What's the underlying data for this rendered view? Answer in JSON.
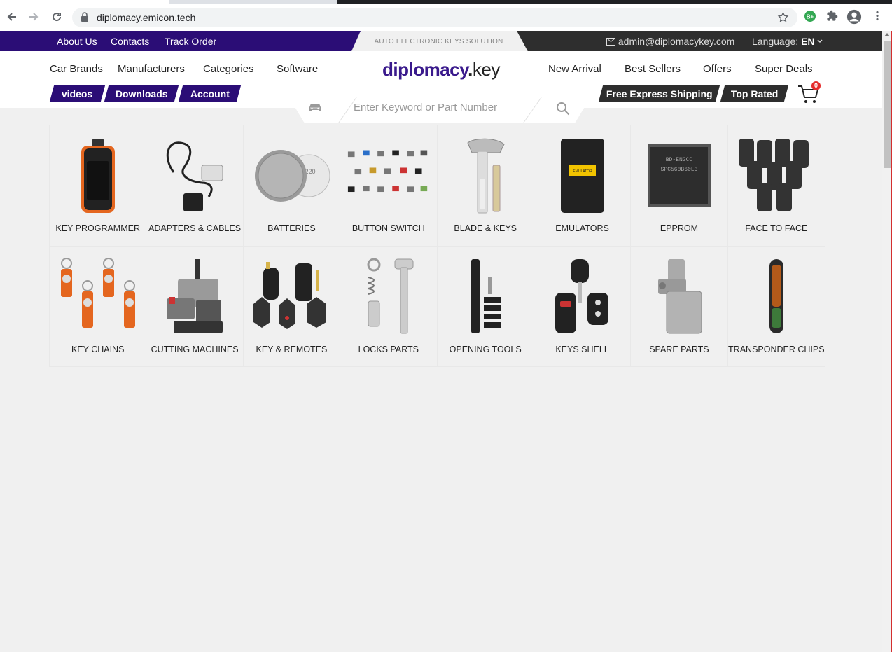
{
  "browser": {
    "url": "diplomacy.emicon.tech",
    "back_icon": "arrow-left-icon",
    "forward_icon": "arrow-right-icon",
    "reload_icon": "reload-icon",
    "lock_icon": "lock-icon",
    "star_icon": "star-icon",
    "extension_badge": "B+",
    "extension_badge_color": "#34a853"
  },
  "topbar": {
    "links": [
      "About Us",
      "Contacts",
      "Track Order"
    ],
    "tagline": "AUTO ELECTRONIC KEYS SOLUTION",
    "email": "admin@diplomacykey.com",
    "language_label": "Language:",
    "language_value": "EN",
    "brand_color": "#2b0d76",
    "dark_color": "#2e2e2e"
  },
  "nav": {
    "left": [
      "Car Brands",
      "Manufacturers",
      "Categories",
      "Software"
    ],
    "right": [
      "New Arrival",
      "Best Sellers",
      "Offers",
      "Super Deals"
    ]
  },
  "logo": {
    "part1": "diplomacy",
    "dot": ".",
    "part2": "key"
  },
  "pills": {
    "left": [
      "videos",
      "Downloads",
      "Account"
    ],
    "right": [
      "Free Express Shipping",
      "Top Rated"
    ]
  },
  "cart": {
    "count": "0",
    "badge_color": "#e52b2b"
  },
  "search": {
    "placeholder": "Enter Keyword or Part Number"
  },
  "categories": [
    {
      "label": "KEY PROGRAMMER",
      "icon": "key-programmer-image"
    },
    {
      "label": "ADAPTERS & CABLES",
      "icon": "cable-image"
    },
    {
      "label": "BATTERIES",
      "icon": "battery-image"
    },
    {
      "label": "BUTTON SWITCH",
      "icon": "button-switch-image"
    },
    {
      "label": "BLADE & KEYS",
      "icon": "key-blade-image"
    },
    {
      "label": "EMULATORS",
      "icon": "emulator-image"
    },
    {
      "label": "EPPROM",
      "icon": "chip-image"
    },
    {
      "label": "FACE TO FACE",
      "icon": "remote-keys-image"
    },
    {
      "label": "KEY CHAINS",
      "icon": "keychain-image"
    },
    {
      "label": "CUTTING MACHINES",
      "icon": "cutting-machine-image"
    },
    {
      "label": "KEY & REMOTES",
      "icon": "remote-image"
    },
    {
      "label": "LOCKS PARTS",
      "icon": "lock-parts-image"
    },
    {
      "label": "OPENING TOOLS",
      "icon": "opening-tool-image"
    },
    {
      "label": "KEYS SHELL",
      "icon": "key-shell-image"
    },
    {
      "label": "SPARE PARTS",
      "icon": "spare-part-image"
    },
    {
      "label": "TRANSPONDER CHIPS",
      "icon": "transponder-image"
    }
  ],
  "image_text": {
    "battery": "220",
    "emulator": "EMULATOR",
    "eprom_line1": "BD-ENGCC",
    "eprom_line2": "SPC560B60L3"
  }
}
